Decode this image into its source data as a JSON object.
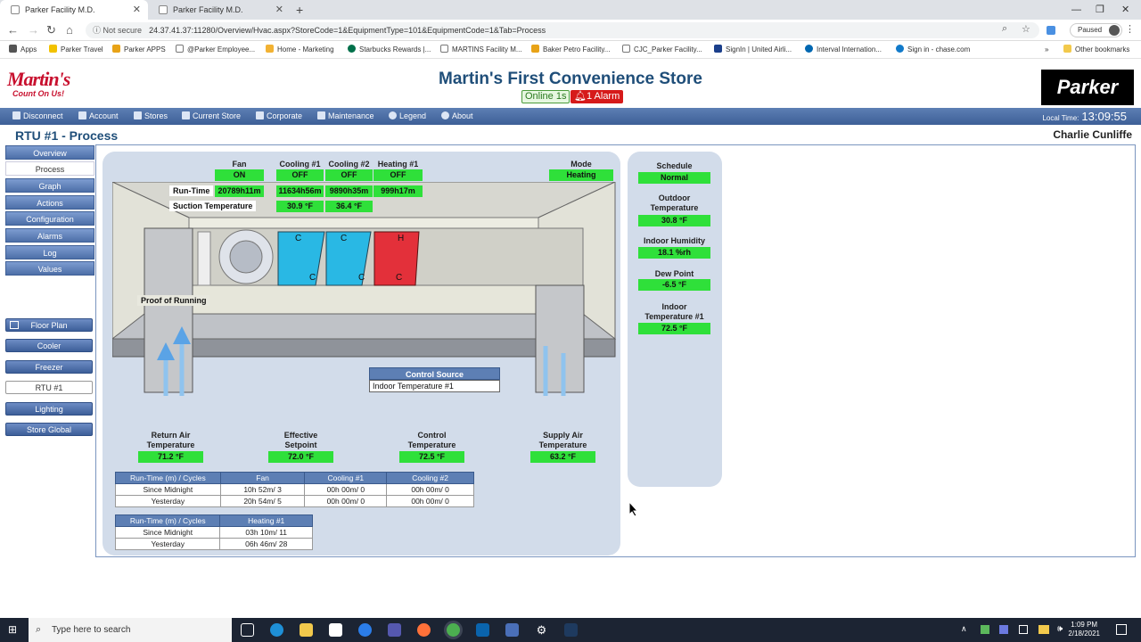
{
  "browser": {
    "tabs": [
      {
        "title": "Parker Facility M.D.",
        "active": true
      },
      {
        "title": "Parker Facility M.D.",
        "active": false
      }
    ],
    "security": "Not secure",
    "url": "24.37.41.37:11280/Overview/Hvac.aspx?StoreCode=1&EquipmentType=101&EquipmentCode=1&Tab=Process",
    "profile_status": "Paused",
    "bookmarks": [
      "Apps",
      "Parker Travel",
      "Parker APPS",
      "@Parker Employee...",
      "Home - Marketing",
      "Starbucks Rewards |...",
      "MARTINS Facility M...",
      "Baker Petro Facility...",
      "CJC_Parker Facility...",
      "SignIn | United Airli...",
      "Interval Internation...",
      "Sign in - chase.com"
    ],
    "other_bookmarks": "Other bookmarks"
  },
  "header": {
    "logo_main": "Martin's",
    "logo_tag": "Count On Us!",
    "store_name": "Martin's First Convenience Store",
    "online": "Online 1s",
    "alarm": "1 Alarm",
    "brand": "Parker"
  },
  "menu": [
    "Disconnect",
    "Account",
    "Stores",
    "Current Store",
    "Corporate",
    "Maintenance",
    "Legend",
    "About"
  ],
  "local_time_label": "Local Time:",
  "local_time": "13:09:55",
  "page_title": "RTU #1 - Process",
  "user": "Charlie Cunliffe",
  "side_nav": [
    "Overview",
    "Process",
    "Graph",
    "Actions",
    "Configuration",
    "Alarms",
    "Log",
    "Values"
  ],
  "side_nav_selected": "Process",
  "equipment_nav": [
    "Floor Plan",
    "Cooler",
    "Freezer",
    "RTU #1",
    "Lighting",
    "Store Global"
  ],
  "equipment_selected": "RTU #1",
  "process": {
    "stages": [
      {
        "name": "Fan",
        "state": "ON",
        "runtime": "20789h11m",
        "suction": ""
      },
      {
        "name": "Cooling #1",
        "state": "OFF",
        "runtime": "11634h56m",
        "suction": "30.9 °F"
      },
      {
        "name": "Cooling #2",
        "state": "OFF",
        "runtime": "9890h35m",
        "suction": "36.4 °F"
      },
      {
        "name": "Heating #1",
        "state": "OFF",
        "runtime": "999h17m",
        "suction": ""
      }
    ],
    "runtime_label": "Run-Time",
    "suction_label": "Suction Temperature",
    "mode_label": "Mode",
    "mode_value": "Heating",
    "proof_label": "Proof of Running",
    "coil_letters": {
      "c": "C",
      "h": "H"
    },
    "control_source": {
      "label": "Control Source",
      "value": "Indoor Temperature #1"
    },
    "readings": [
      {
        "label": "Return Air Temperature",
        "value": "71.2 °F"
      },
      {
        "label": "Effective Setpoint",
        "value": "72.0 °F"
      },
      {
        "label": "Control Temperature",
        "value": "72.5 °F"
      },
      {
        "label": "Supply Air Temperature",
        "value": "63.2 °F"
      }
    ]
  },
  "runtime_table1": {
    "headers": [
      "Run-Time (m) / Cycles",
      "Fan",
      "Cooling #1",
      "Cooling #2"
    ],
    "rows": [
      [
        "Since Midnight",
        "10h 52m/ 3",
        "00h 00m/ 0",
        "00h 00m/ 0"
      ],
      [
        "Yesterday",
        "20h 54m/ 5",
        "00h 00m/ 0",
        "00h 00m/ 0"
      ]
    ]
  },
  "runtime_table2": {
    "headers": [
      "Run-Time (m) / Cycles",
      "Heating #1"
    ],
    "rows": [
      [
        "Since Midnight",
        "03h 10m/ 11"
      ],
      [
        "Yesterday",
        "06h 46m/ 28"
      ]
    ]
  },
  "side_readings": [
    {
      "label": "Schedule",
      "value": "Normal"
    },
    {
      "label": "Outdoor Temperature",
      "value": "30.8 °F"
    },
    {
      "label": "Indoor Humidity",
      "value": "18.1 %rh"
    },
    {
      "label": "Dew Point",
      "value": "-6.5 °F"
    },
    {
      "label": "Indoor Temperature #1",
      "value": "72.5 °F"
    }
  ],
  "taskbar": {
    "search_placeholder": "Type here to search",
    "time": "1:09 PM",
    "date": "2/18/2021"
  },
  "colors": {
    "accent": "#1f4e79",
    "menu": "#4d6fa8",
    "status_green": "#2fe03a",
    "alarm": "#d61a1a"
  }
}
